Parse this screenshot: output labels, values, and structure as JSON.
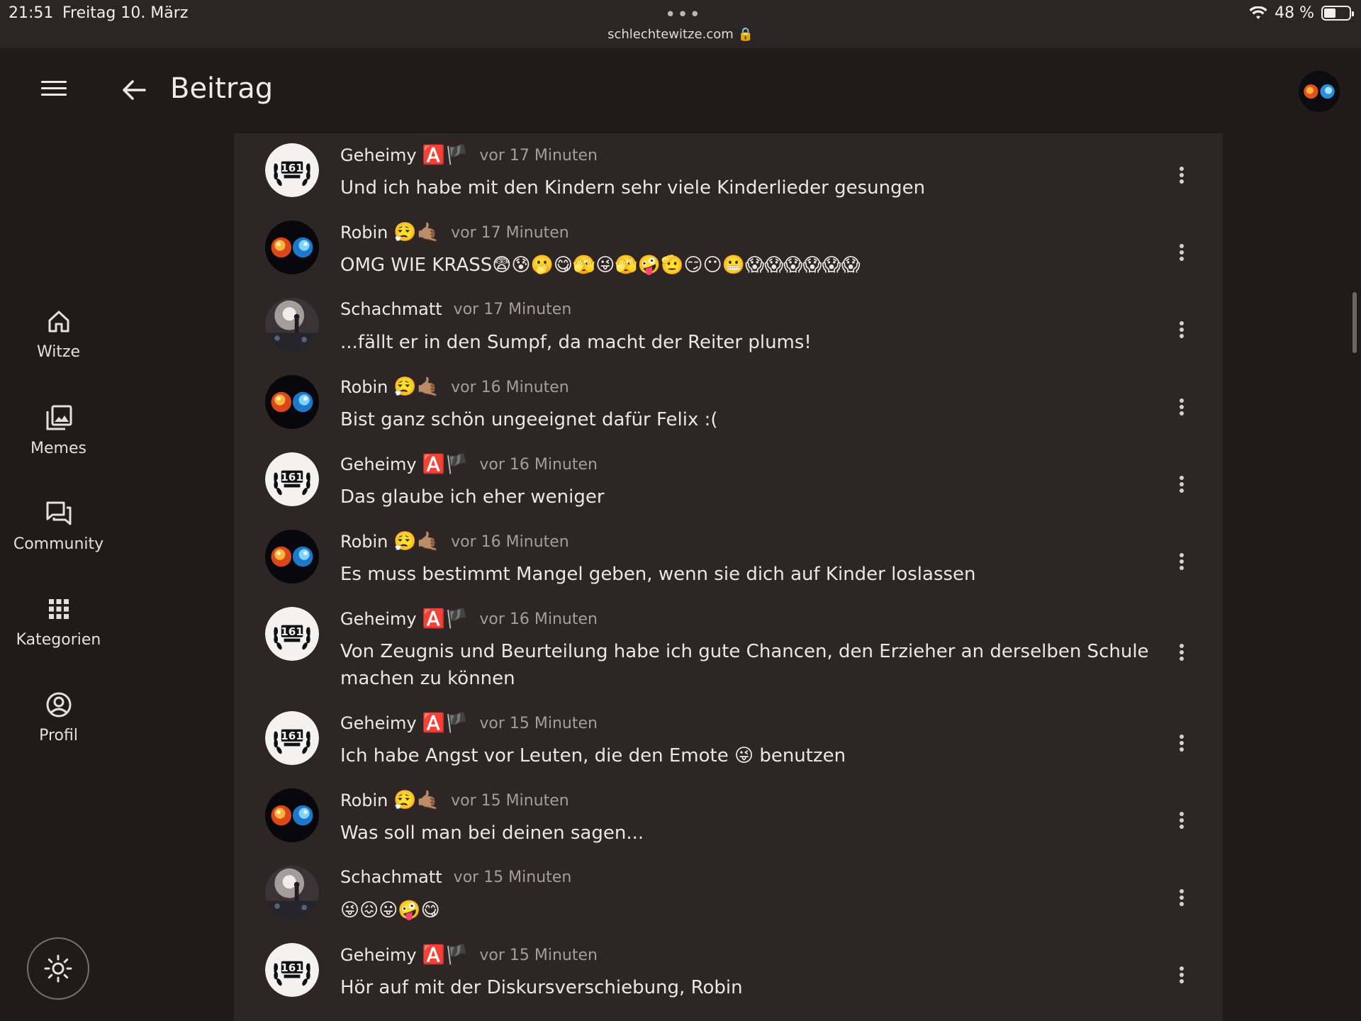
{
  "status_bar": {
    "time": "21:51",
    "date": "Freitag 10. März",
    "url": "schlechtewitze.com 🔒",
    "battery": "48 %",
    "battery_level_percent": 48
  },
  "header": {
    "title": "Beitrag"
  },
  "sidebar": {
    "items": [
      {
        "label": "Witze",
        "icon": "home-icon"
      },
      {
        "label": "Memes",
        "icon": "images-icon"
      },
      {
        "label": "Community",
        "icon": "forum-icon"
      },
      {
        "label": "Kategorien",
        "icon": "grid-icon"
      },
      {
        "label": "Profil",
        "icon": "account-circle-icon"
      }
    ],
    "theme_toggle_icon": "sun-icon"
  },
  "comments": [
    {
      "user": "Geheimy",
      "badges": "🅰️🏴",
      "time": "vor 17 Minuten",
      "text": "Und ich habe mit den Kindern sehr viele Kinderlieder gesungen"
    },
    {
      "user": "Robin",
      "badges": "😮‍💨🤙🏽",
      "time": "vor 17 Minuten",
      "text": "OMG WIE KRASS😨😰🫢😋🫣😜🫣🤪🫡😏😶😬😱😱😱😱😱😱"
    },
    {
      "user": "Schachmatt",
      "badges": "",
      "time": "vor 17 Minuten",
      "text": "...fällt er in den Sumpf, da macht der Reiter plums!"
    },
    {
      "user": "Robin",
      "badges": "😮‍💨🤙🏽",
      "time": "vor 16 Minuten",
      "text": "Bist ganz schön ungeeignet dafür Felix :("
    },
    {
      "user": "Geheimy",
      "badges": "🅰️🏴",
      "time": "vor 16 Minuten",
      "text": "Das glaube ich eher weniger"
    },
    {
      "user": "Robin",
      "badges": "😮‍💨🤙🏽",
      "time": "vor 16 Minuten",
      "text": "Es muss bestimmt Mangel geben, wenn sie dich auf Kinder loslassen"
    },
    {
      "user": "Geheimy",
      "badges": "🅰️🏴",
      "time": "vor 16 Minuten",
      "text": "Von Zeugnis und Beurteilung habe ich gute Chancen, den Erzieher an derselben Schule machen zu können"
    },
    {
      "user": "Geheimy",
      "badges": "🅰️🏴",
      "time": "vor 15 Minuten",
      "text": "Ich habe Angst vor Leuten, die den Emote 😜 benutzen"
    },
    {
      "user": "Robin",
      "badges": "😮‍💨🤙🏽",
      "time": "vor 15 Minuten",
      "text": "Was soll man bei deinen sagen..."
    },
    {
      "user": "Schachmatt",
      "badges": "",
      "time": "vor 15 Minuten",
      "text": "😜😖😛🤪😋"
    },
    {
      "user": "Geheimy",
      "badges": "🅰️🏴",
      "time": "vor 15 Minuten",
      "text": "Hör auf mit der Diskursverschiebung, Robin"
    }
  ],
  "avatar_icons": {
    "Geheimy": "laurel-161-logo-avatar",
    "Robin": "fire-ice-avatar",
    "Schachmatt": "concert-photo-avatar"
  },
  "colors": {
    "background": "#201b19",
    "panel": "#2d2624",
    "text": "#ece6e2",
    "muted": "#a59d99"
  }
}
